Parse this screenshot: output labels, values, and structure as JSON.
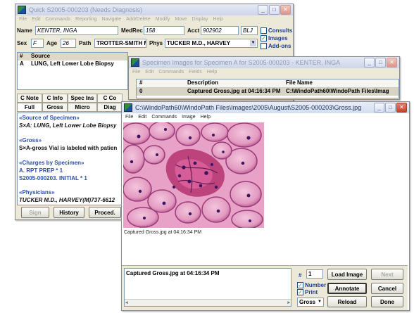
{
  "main": {
    "title": "Quick S2005-000203 (Needs Diagnosis)",
    "menu": [
      "File",
      "Edit",
      "Commands",
      "Reporting",
      "Navigate",
      "Add/Delete",
      "Modify",
      "Move",
      "Display",
      "Help"
    ],
    "name_label": "Name",
    "name_value": "KENTER, INGA",
    "medrec_label": "MedRec",
    "medrec_value": "158",
    "acct_label": "Acct",
    "acct_value": "902902",
    "blj": "BLJ",
    "consults": "Consults",
    "images": "Images",
    "addons": "Add-ons",
    "sex_label": "Sex",
    "sex_value": "F",
    "age_label": "Age",
    "age_value": "26",
    "path_label": "Path",
    "path_value": "TROTTER-SMITH MD,",
    "phys_label": "Phys",
    "phys_value": "TUCKER M.D., HARVEY",
    "spec_header_hash": "#",
    "spec_header_source": "Source",
    "spec_row_id": "A",
    "spec_row_source": "LUNG, Left Lower Lobe Biopsy",
    "tabs_row1": [
      "C Note",
      "C Info",
      "Spec Ins",
      "C Co"
    ],
    "tabs_row2": [
      "Full",
      "Gross",
      "Micro",
      "Diag"
    ],
    "report": [
      {
        "kind": "head",
        "text": "«Source of Specimen»"
      },
      {
        "kind": "body",
        "text": "S×A: LUNG, Left Lower Lobe Biopsy"
      },
      {
        "kind": "head",
        "text": "«Gross»"
      },
      {
        "kind": "body",
        "text": "S×A-gross Vial is labeled with patien"
      },
      {
        "kind": "head",
        "text": "«Charges by Specimen»"
      },
      {
        "kind": "head",
        "text": "A. RPT PREP * 1"
      },
      {
        "kind": "head",
        "text": "S2005-000203. INITIAL * 1"
      },
      {
        "kind": "head",
        "text": "«Physicians»"
      },
      {
        "kind": "body",
        "text": "TUCKER M.D., HARVEY(M)737-6612"
      }
    ],
    "sign": "Sign",
    "history": "History",
    "proced": "Proced."
  },
  "specimen": {
    "title": "Specimen Images for Specimen A for S2005-000203 - KENTER, INGA",
    "menu": [
      "File",
      "Edit",
      "Commands",
      "Fields",
      "Help"
    ],
    "col_hash": "#",
    "col_desc": "Description",
    "col_file": "File Name",
    "row_num": "0",
    "row_desc": "Captured Gross.jpg at 04:16:34 PM",
    "row_file": "C:\\WindoPath60\\WindoPath Files\\Imag"
  },
  "viewer": {
    "title": "C:\\WindoPath60\\WindoPath Files\\Images\\2005\\August\\S2005-000203\\Gross.jpg",
    "menu": [
      "File",
      "Edit",
      "Commands",
      "Image",
      "Help"
    ],
    "caption": "Captured Gross.jpg at 04:16:34 PM",
    "note": "Captured Gross.jpg at 04:16:34 PM",
    "num_label": "#",
    "num_value": "1",
    "load_image": "Load Image",
    "next": "Next",
    "number": "Number",
    "print": "Print",
    "annotate": "Annotate",
    "cancel": "Cancel",
    "gross": "Gross",
    "reload": "Reload",
    "done": "Done"
  }
}
